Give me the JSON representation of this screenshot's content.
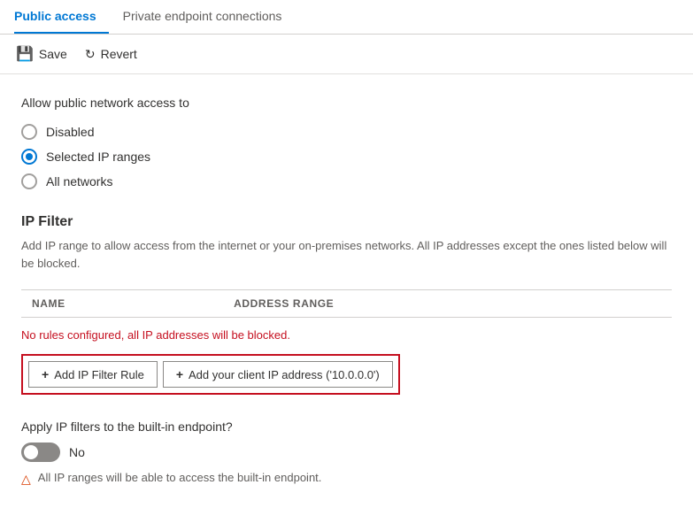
{
  "tabs": [
    {
      "id": "public-access",
      "label": "Public access",
      "active": true
    },
    {
      "id": "private-endpoint",
      "label": "Private endpoint connections",
      "active": false
    }
  ],
  "toolbar": {
    "save_label": "Save",
    "revert_label": "Revert"
  },
  "content": {
    "network_access_label": "Allow public network access to",
    "radio_options": [
      {
        "id": "disabled",
        "label": "Disabled",
        "selected": false
      },
      {
        "id": "selected-ip-ranges",
        "label": "Selected IP ranges",
        "selected": true
      },
      {
        "id": "all-networks",
        "label": "All networks",
        "selected": false
      }
    ],
    "ip_filter": {
      "title": "IP Filter",
      "description": "Add IP range to allow access from the internet or your on-premises networks. All IP addresses except the ones listed below will be blocked.",
      "table": {
        "columns": [
          "NAME",
          "ADDRESS RANGE"
        ],
        "rows": []
      },
      "no_rules_text": "No rules configured, all IP addresses will be blocked.",
      "buttons": [
        {
          "id": "add-ip-filter",
          "label": "Add IP Filter Rule"
        },
        {
          "id": "add-client-ip",
          "label": "Add your client IP address ('10.0.0.0')"
        }
      ]
    },
    "apply_ip_filters": {
      "label": "Apply IP filters to the built-in endpoint?",
      "toggle_state": "off",
      "toggle_text": "No",
      "warning_text": "All IP ranges will be able to access the built-in endpoint."
    }
  },
  "icons": {
    "save": "💾",
    "revert": "↺",
    "plus": "+",
    "warning": "⚠"
  }
}
